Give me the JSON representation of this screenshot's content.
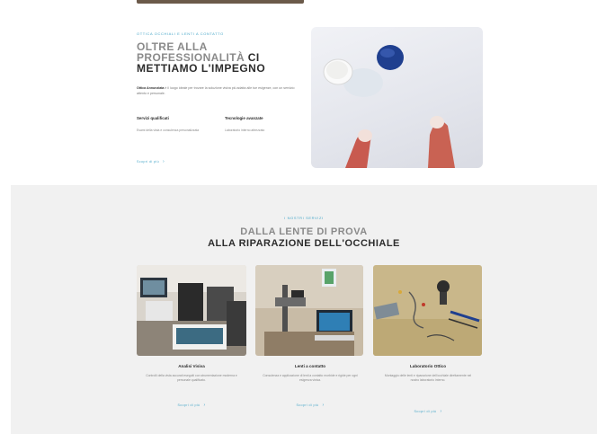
{
  "colors": {
    "accent": "#4aa8c9",
    "heading_dark": "#2c2c2c",
    "heading_light": "#8a8a8a",
    "section_bg": "#f1f1f1"
  },
  "about": {
    "eyebrow": "Ottica Occhiali e Lenti a Contatto",
    "heading_light": "Oltre alla professionalità",
    "heading_accent": "ci",
    "heading_bold": "mettiamo l'impegno",
    "text_strong": "Ottica Annunziata",
    "text": "è il luogo ideale per trovare la soluzione visiva più adatta alle tue esigenze, con un servizio attento e personale.",
    "features": [
      {
        "title": "Servizi qualificati",
        "text": "Esami della vista e consulenza personalizzata"
      },
      {
        "title": "Tecnologie avanzate",
        "text": "Laboratorio interno attrezzato"
      }
    ],
    "link_label": "Scopri di più",
    "image_icon": "contact-lens-photo"
  },
  "services": {
    "eyebrow": "I nostri servizi",
    "heading_light": "Dalla lente di prova",
    "heading_bold": "alla riparazione dell'occhiale",
    "cards": [
      {
        "title": "Analisi Visiva",
        "text": "Controlli della vista accurati eseguiti con strumentazione moderna e personale qualificato.",
        "link": "Scopri di più",
        "image_icon": "eye-exam-equipment-photo"
      },
      {
        "title": "Lenti a contatto",
        "text": "Consulenza e applicazione di lenti a contatto morbide e rigide per ogni esigenza visiva.",
        "link": "Scopri di più",
        "image_icon": "contact-lens-fitting-photo"
      },
      {
        "title": "Laboratorio Ottico",
        "text": "Montaggio delle lenti e riparazione dell'occhiale direttamente nel nostro laboratorio interno.",
        "link": "Scopri di più",
        "image_icon": "optical-lab-tools-photo"
      }
    ]
  }
}
